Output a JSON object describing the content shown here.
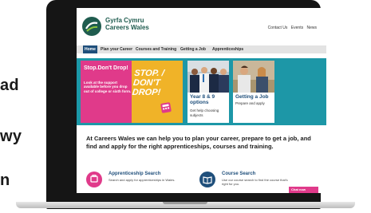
{
  "background_words": [
    "ad",
    "wy",
    "n"
  ],
  "site": {
    "logo_line1": "Gyrfa Cymru",
    "logo_line2": "Careers Wales",
    "top_links": [
      "Contact Us",
      "Events",
      "News"
    ]
  },
  "nav": {
    "items": [
      "Home",
      "Plan your Career",
      "Courses and Training",
      "Getting a Job",
      "Apprenticeships"
    ],
    "active": "Home"
  },
  "promo": {
    "title": "Stop.Don't Drop!",
    "body": "Look at the support available before you drop out of college or sixth form.",
    "art_text_line1": "STOP. /",
    "art_text_line2": "DON'T DROP!"
  },
  "tiles": [
    {
      "title": "Year 8 & 9 options",
      "desc": "Get help choosing subjects"
    },
    {
      "title": "Getting a Job",
      "desc": "Prepare and apply"
    }
  ],
  "intro": "At Careers Wales we can help you to plan your career, prepare to get a job, and find and apply for the right apprenticeships, courses and training.",
  "services": [
    {
      "title": "Apprenticeship Search",
      "desc": "Search and apply for apprenticeships in Wales."
    },
    {
      "title": "Course Search",
      "desc": "Use our course search to find the course that's right for you."
    }
  ],
  "chat_label": "Chat now",
  "colors": {
    "brand_green": "#1f5c4f",
    "nav_blue": "#1f4f7b",
    "hero_teal": "#1d97a7",
    "promo_pink": "#e03a8a",
    "promo_yellow": "#f0b328"
  }
}
